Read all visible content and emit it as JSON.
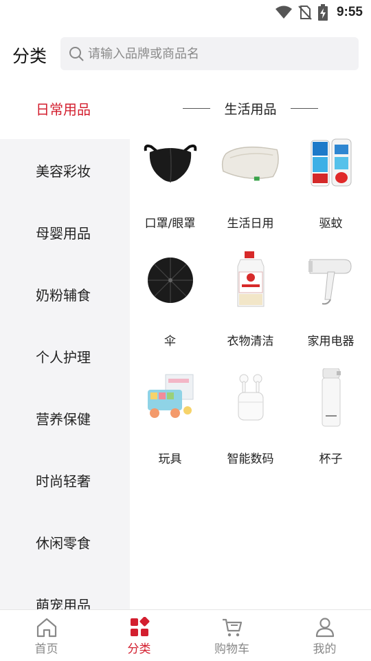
{
  "status_bar": {
    "time": "9:55"
  },
  "header": {
    "title": "分类",
    "search_placeholder": "请输入品牌或商品名"
  },
  "sidebar": {
    "items": [
      {
        "label": "日常用品",
        "active": true
      },
      {
        "label": "美容彩妆"
      },
      {
        "label": "母婴用品"
      },
      {
        "label": "奶粉辅食"
      },
      {
        "label": "个人护理"
      },
      {
        "label": "营养保健"
      },
      {
        "label": "时尚轻奢"
      },
      {
        "label": "休闲零食"
      },
      {
        "label": "萌宠用品"
      }
    ]
  },
  "section": {
    "title": "生活用品"
  },
  "products": [
    {
      "label": "口罩/眼罩",
      "icon": "mask-icon"
    },
    {
      "label": "生活日用",
      "icon": "pillow-icon"
    },
    {
      "label": "驱蚊",
      "icon": "mosquito-repellent-icon"
    },
    {
      "label": "伞",
      "icon": "umbrella-icon"
    },
    {
      "label": "衣物清洁",
      "icon": "detergent-icon"
    },
    {
      "label": "家用电器",
      "icon": "hair-dryer-icon"
    },
    {
      "label": "玩具",
      "icon": "toy-icon"
    },
    {
      "label": "智能数码",
      "icon": "earbuds-icon"
    },
    {
      "label": "杯子",
      "icon": "thermos-cup-icon"
    }
  ],
  "tabbar": {
    "tabs": [
      {
        "label": "首页",
        "icon": "home-icon"
      },
      {
        "label": "分类",
        "icon": "category-icon",
        "active": true
      },
      {
        "label": "购物车",
        "icon": "cart-icon"
      },
      {
        "label": "我的",
        "icon": "user-icon"
      }
    ]
  },
  "colors": {
    "accent": "#d31f2f",
    "sidebar_bg": "#f4f4f6"
  }
}
